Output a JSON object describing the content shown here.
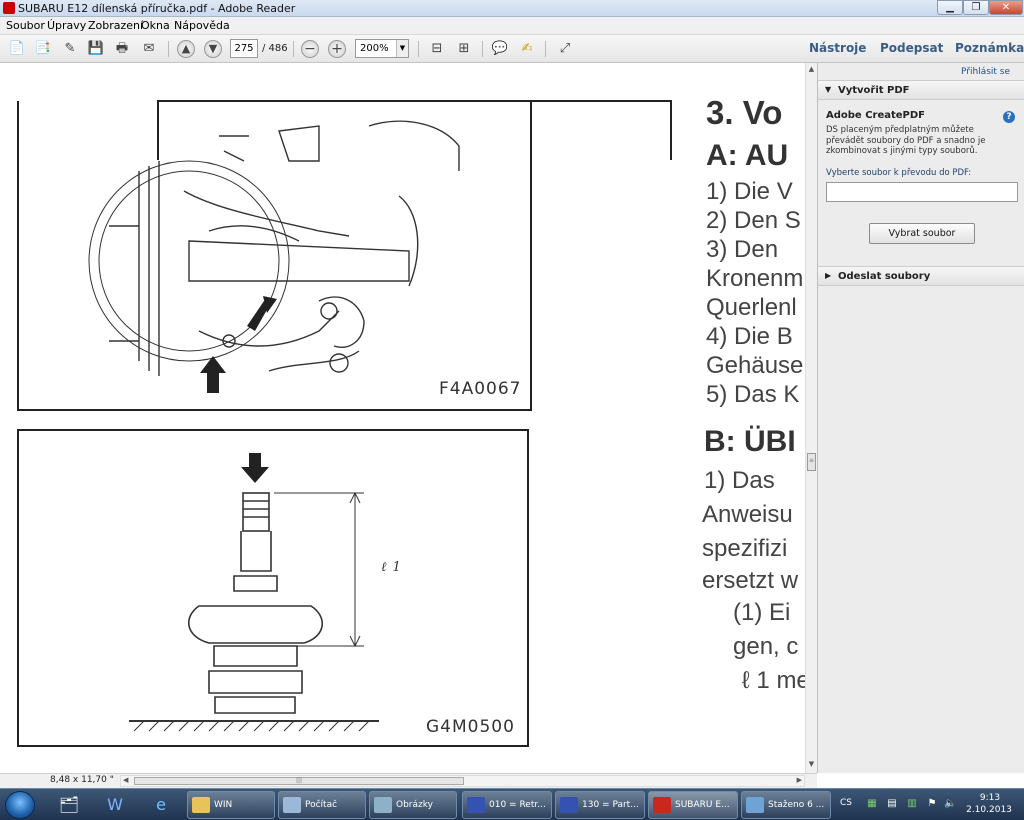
{
  "window": {
    "title": "SUBARU E12 dílenská příručka.pdf - Adobe Reader"
  },
  "menubar": {
    "items": [
      "Soubor",
      "Úpravy",
      "Zobrazení",
      "Okna",
      "Nápověda"
    ]
  },
  "toolbar": {
    "page_current": "275",
    "page_total": "/ 486",
    "zoom": "200%",
    "right_tabs": [
      "Nástroje",
      "Podepsat",
      "Poznámka"
    ]
  },
  "document": {
    "figure1_label": "F4A0067",
    "figure2_label": "G4M0500",
    "figure2_dim_label": "ℓ 1",
    "text_lines": [
      "3.  Vo",
      "A:  AU",
      "1) Die V",
      "2) Den S",
      "3) Den",
      "Kronenm",
      "Querlenl",
      "4) Die B",
      "Gehäuse",
      "5) Das K",
      "B:  ÜBI",
      "1) Das",
      "Anweisu",
      "spezifizi",
      "ersetzt w",
      "(1) Ei",
      "gen, c",
      "ℓ 1 me"
    ]
  },
  "right_panel": {
    "signin": "Přihlásit se",
    "section_create": "Vytvořit PDF",
    "create_title": "Adobe CreatePDF",
    "create_desc": "DS placeným předplatným můžete převádět soubory do PDF a snadno je zkombinovat s jinými typy souborů.",
    "select_label": "Vyberte soubor k převodu do PDF:",
    "select_button": "Vybrat soubor",
    "section_send": "Odeslat soubory"
  },
  "statusbar": {
    "page_size": "8,48 x 11,70 \""
  },
  "taskbar": {
    "buttons": [
      "WIN",
      "Počítač",
      "Obrázky",
      "010 = Retr...",
      "130 = Part...",
      "SUBARU E...",
      "Staženo 6 ..."
    ],
    "lang": "CS",
    "time": "9:13",
    "date": "2.10.2013"
  },
  "colors": {
    "accent": "#3a5d86",
    "taskbar": "#1f3350",
    "panel": "#ececec"
  }
}
